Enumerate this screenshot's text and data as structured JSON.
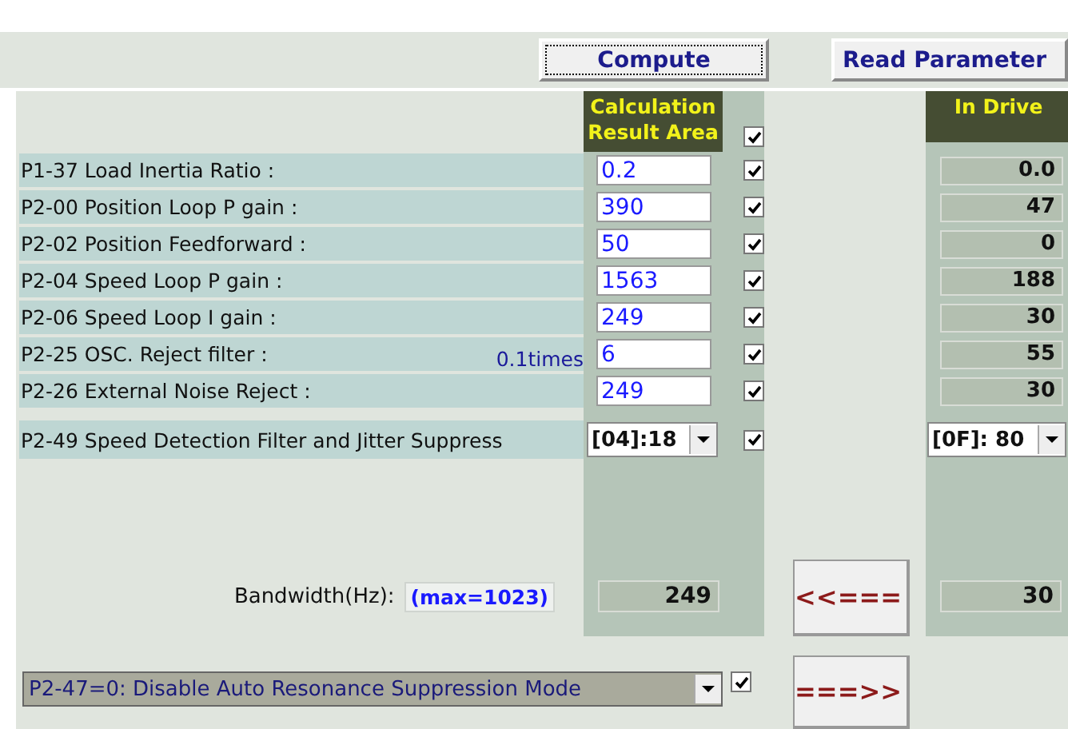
{
  "buttons": {
    "compute": "Compute",
    "read": "Read Parameter"
  },
  "calc_header": {
    "title": "Calculation Result Area",
    "checked": true
  },
  "drive_header": "In Drive",
  "params": [
    {
      "label": "P1-37 Load Inertia Ratio :",
      "value": "0.2",
      "checked": true,
      "drive_value": "0.0"
    },
    {
      "label": "P2-00 Position Loop P gain :",
      "value": "390",
      "checked": true,
      "drive_value": "47"
    },
    {
      "label": "P2-02 Position Feedforward :",
      "value": "50",
      "checked": true,
      "drive_value": "0"
    },
    {
      "label": "P2-04 Speed Loop P gain :",
      "value": "1563",
      "checked": true,
      "drive_value": "188"
    },
    {
      "label": "P2-06 Speed Loop I gain :",
      "value": "249",
      "checked": true,
      "drive_value": "30"
    },
    {
      "label": "P2-25 OSC. Reject filter :",
      "unit": "0.1times",
      "value": "6",
      "checked": true,
      "drive_value": "55"
    },
    {
      "label": "P2-26 External Noise Reject :",
      "value": "249",
      "checked": true,
      "drive_value": "30"
    }
  ],
  "detection": {
    "label": "P2-49 Speed Detection Filter and Jitter Suppress",
    "value": "[04]:18",
    "checked": true,
    "drive_value": "[0F]: 80"
  },
  "bandwidth": {
    "label": "Bandwidth(Hz):",
    "hint": "(max=1023)",
    "value": "249",
    "drive_value": "30"
  },
  "copy_to_calc_button": "<<===",
  "copy_to_drive_button": "===>>",
  "resonance": {
    "value": "P2-47=0: Disable Auto Resonance Suppression Mode",
    "checked": true
  }
}
